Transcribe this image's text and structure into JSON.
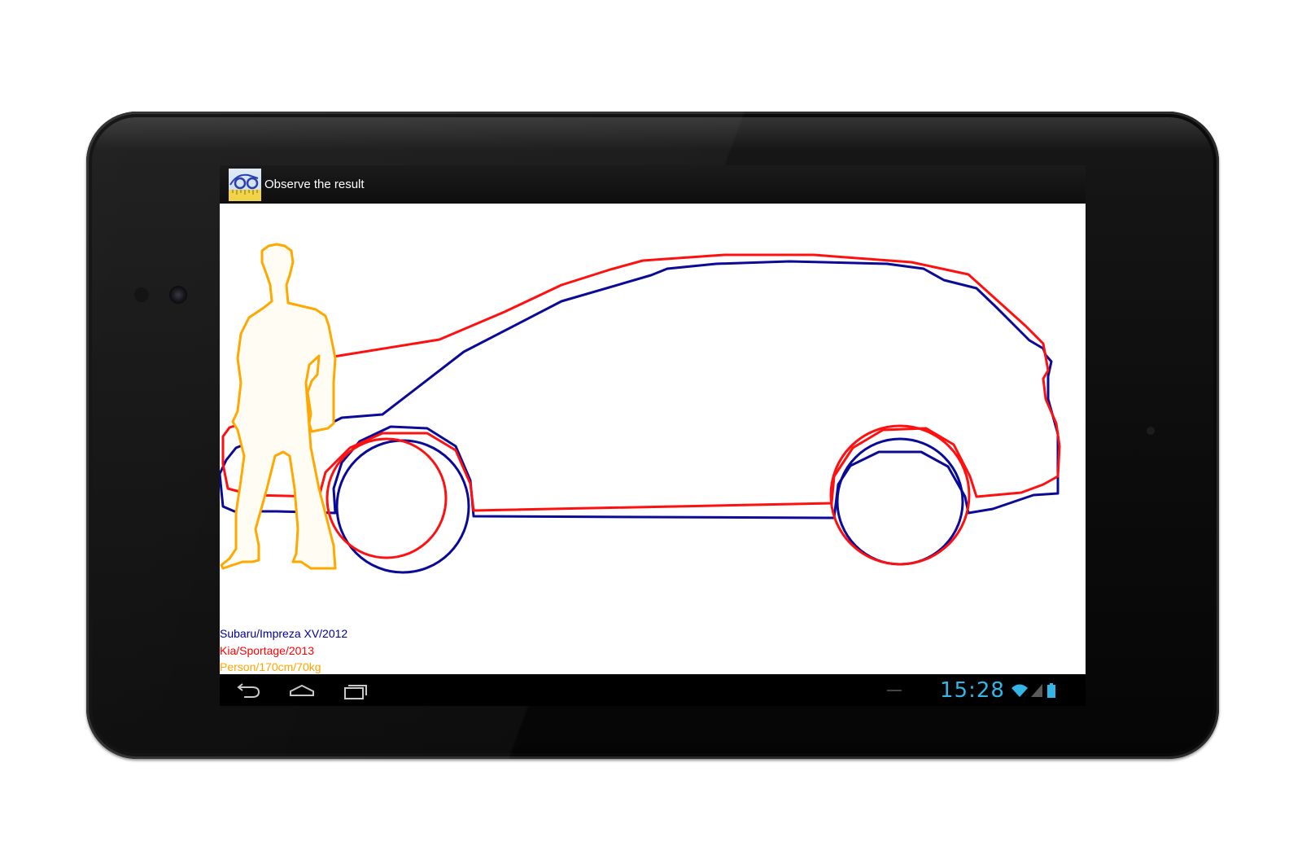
{
  "app": {
    "title": "Observe the result",
    "icon": "app-logo-icon"
  },
  "legend": [
    {
      "label": "Subaru/Impreza XV/2012",
      "color": "#000099"
    },
    {
      "label": "Kia/Sportage/2013",
      "color": "#ff0000"
    },
    {
      "label": "Person/170cm/70kg",
      "color": "#ffa500"
    }
  ],
  "drawing": {
    "subaru_color": "#0a0a96",
    "kia_color": "#ff1010",
    "person_color": "#ffa800"
  },
  "nav": {
    "back": "back-icon",
    "home": "home-icon",
    "recents": "recents-icon"
  },
  "status": {
    "time": "15:28",
    "icons": [
      "wifi-icon",
      "signal-icon",
      "battery-icon"
    ],
    "accent": "#33b5e5"
  },
  "device": {
    "bezel_color": "#0d0d0d"
  }
}
